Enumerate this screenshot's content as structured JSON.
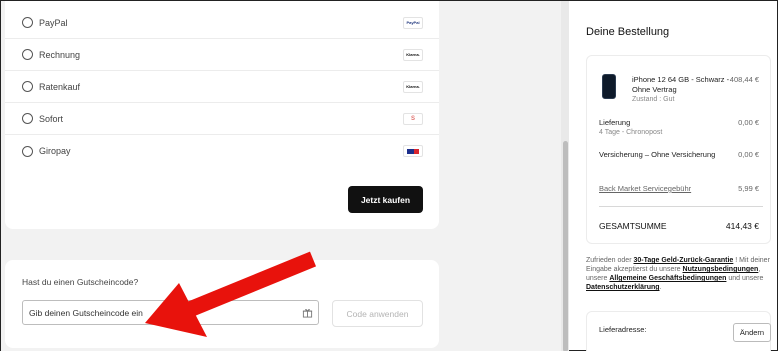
{
  "payment": {
    "methods": [
      {
        "label": "PayPal",
        "logo_text": "PayPal",
        "icon": "paypal-logo"
      },
      {
        "label": "Rechnung",
        "logo_text": "Klarna.",
        "icon": "klarna-logo"
      },
      {
        "label": "Ratenkauf",
        "logo_text": "Klarna.",
        "icon": "klarna-logo"
      },
      {
        "label": "Sofort",
        "logo_text": "S",
        "icon": "sofort-logo"
      },
      {
        "label": "Giropay",
        "logo_text": "",
        "icon": "giropay-logo"
      }
    ],
    "buy_label": "Jetzt kaufen"
  },
  "voucher": {
    "question": "Hast du einen Gutscheincode?",
    "placeholder": "Gib deinen Gutscheincode ein",
    "apply_label": "Code anwenden"
  },
  "order": {
    "title": "Deine Bestellung",
    "product": {
      "name": "iPhone 12 64 GB - Schwarz - Ohne Vertrag",
      "condition": "Zustand : Gut",
      "price": "408,44 €"
    },
    "shipping_label": "Lieferung",
    "shipping_sub": "4 Tage - Chronopost",
    "shipping_price": "0,00 €",
    "insurance_label": "Versicherung – Ohne Versicherung",
    "insurance_price": "0,00 €",
    "service_fee_label": "Back Market Servicegebühr",
    "service_fee_price": "5,99 €",
    "total_label": "GESAMTSUMME",
    "total_price": "414,43 €"
  },
  "legal": {
    "t1": "Zufrieden oder ",
    "l1": "30-Tage Geld-Zurück-Garantie",
    "t2": " ! Mit deiner Eingabe akzeptierst du unsere ",
    "l2": "Nutzungsbedingungen",
    "t3": ", unsere ",
    "l3": "Allgemeine Geschäftsbedingungen",
    "t4": " und unsere ",
    "l4": "Datenschutzerklärung",
    "t5": "."
  },
  "address": {
    "label": "Lieferadresse:",
    "change_label": "Ändern"
  },
  "colors": {
    "arrow": "#e8120c",
    "button_dark": "#111111"
  }
}
